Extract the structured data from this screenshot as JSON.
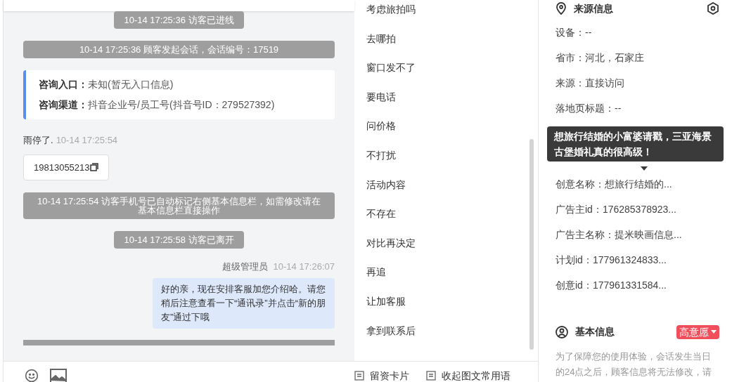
{
  "messages": [
    {
      "kind": "system",
      "text": "10-14 17:25:36 访客已进线"
    },
    {
      "kind": "system",
      "text": "10-14 17:25:36 顾客发起会话，会话编号：17519"
    },
    {
      "kind": "entry",
      "rows": [
        {
          "label": "咨询入口：",
          "value": "未知(暂无入口信息)"
        },
        {
          "label": "咨询渠道：",
          "value": "抖音企业号/员工号(抖音号ID：279527392)"
        }
      ]
    },
    {
      "kind": "visitor",
      "text": "雨停了.",
      "time": "10-14 17:25:54",
      "card": "19813055213"
    },
    {
      "kind": "system",
      "text": "10-14 17:25:54 访客手机号已自动标记右侧基本信息栏，如需修改请在基本信息栏直接操作"
    },
    {
      "kind": "system",
      "text": "10-14 17:25:58 访客已离开"
    },
    {
      "kind": "agent",
      "sender": "超级管理员",
      "time": "10-14 17:26:07",
      "text": "好的亲，现在安排客服加您介绍哈。请您稍后注意查看一下“通讯录”并点击“新的朋友”通过下哦"
    }
  ],
  "quick_replies": [
    "考虑旅拍吗",
    "去哪拍",
    "窗口发不了",
    "要电话",
    "问价格",
    "不打扰",
    "活动内容",
    "不存在",
    "对比再决定",
    "再追",
    "让加客服",
    "拿到联系后"
  ],
  "quick_reply_toolbar": [
    "留资卡片",
    "收起图文常用语"
  ],
  "source_info": {
    "title": "来源信息",
    "fields": [
      {
        "text": "设备：--"
      },
      {
        "text": "省市：河北，石家庄"
      },
      {
        "text": "来源：直接访问"
      },
      {
        "text": "落地页标题：--"
      },
      {
        "text": "创意名称：想旅行结婚的..."
      },
      {
        "text": "广告主id：176285378923..."
      },
      {
        "text": "广告主名称：提米映画信息..."
      },
      {
        "text": "计划id：177961324833..."
      },
      {
        "text": "创意id：177961331584..."
      }
    ],
    "tooltip": {
      "text": "想旅行结婚的小富婆请戳，三亚海景古堡婚礼真的很高级！"
    }
  },
  "basic_info": {
    "title": "基本信息",
    "intent": "高意愿",
    "note": "为了保障您的使用体验，会话发生当日的24点之后，顾客信息将无法修改，请"
  }
}
